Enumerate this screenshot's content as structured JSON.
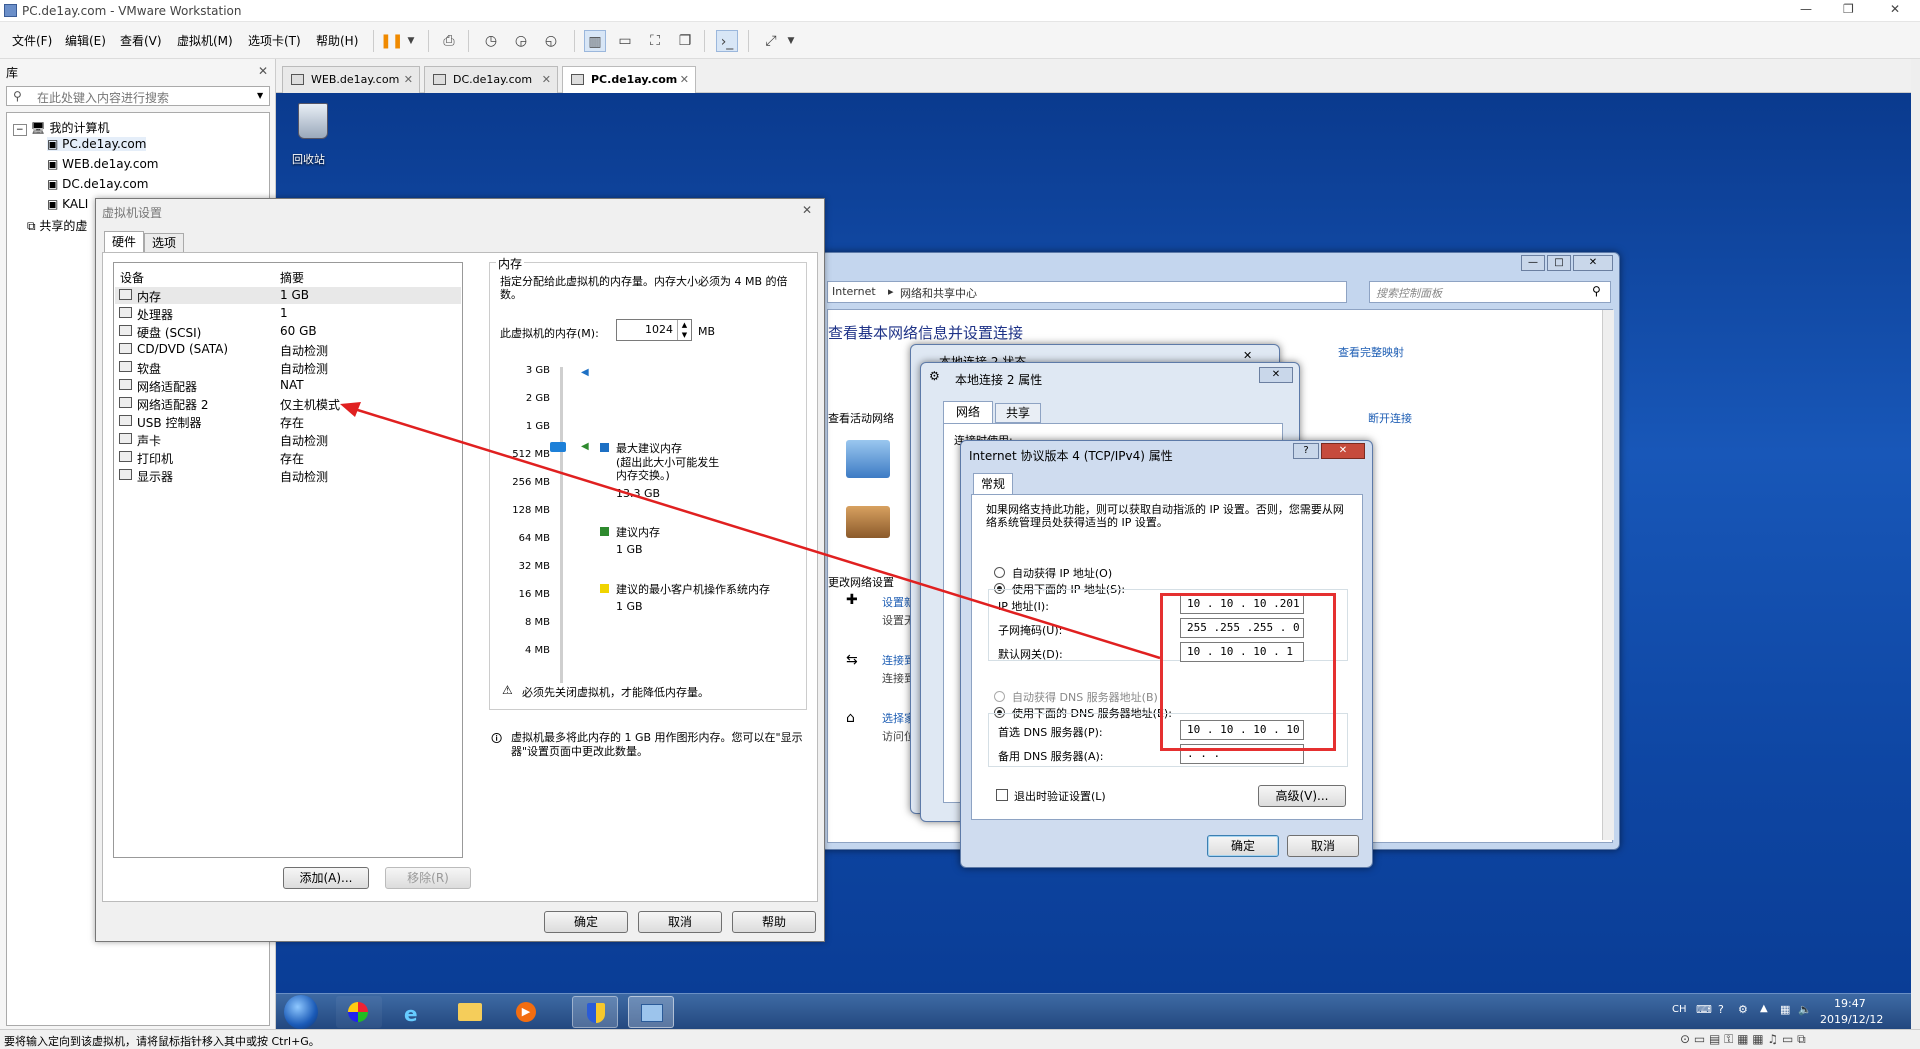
{
  "window": {
    "title": "PC.de1ay.com - VMware Workstation",
    "controls": [
      "—",
      "❐",
      "✕"
    ]
  },
  "menu": [
    "文件(F)",
    "编辑(E)",
    "查看(V)",
    "虚拟机(M)",
    "选项卡(T)",
    "帮助(H)"
  ],
  "library": {
    "title": "库",
    "close": "✕",
    "search_placeholder": "在此处键入内容进行搜索",
    "tree": {
      "root": "我的计算机",
      "items": [
        "PC.de1ay.com",
        "WEB.de1ay.com",
        "DC.de1ay.com",
        "KALI"
      ],
      "shared": "共享的虚"
    }
  },
  "tabs": [
    {
      "label": "WEB.de1ay.com"
    },
    {
      "label": "DC.de1ay.com"
    },
    {
      "label": "PC.de1ay.com"
    }
  ],
  "desktop": {
    "recycle_bin": "回收站"
  },
  "vm_settings": {
    "title": "虚拟机设置",
    "tabs": [
      "硬件",
      "选项"
    ],
    "columns": [
      "设备",
      "摘要"
    ],
    "devices": [
      {
        "name": "内存",
        "summary": "1 GB"
      },
      {
        "name": "处理器",
        "summary": "1"
      },
      {
        "name": "硬盘 (SCSI)",
        "summary": "60 GB"
      },
      {
        "name": "CD/DVD (SATA)",
        "summary": "自动检测"
      },
      {
        "name": "软盘",
        "summary": "自动检测"
      },
      {
        "name": "网络适配器",
        "summary": "NAT"
      },
      {
        "name": "网络适配器 2",
        "summary": "仅主机模式"
      },
      {
        "name": "USB 控制器",
        "summary": "存在"
      },
      {
        "name": "声卡",
        "summary": "自动检测"
      },
      {
        "name": "打印机",
        "summary": "存在"
      },
      {
        "name": "显示器",
        "summary": "自动检测"
      }
    ],
    "memory": {
      "heading": "内存",
      "desc": "指定分配给此虚拟机的内存量。内存大小必须为 4 MB 的倍数。",
      "label": "此虚拟机的内存(M):",
      "value": "1024",
      "unit": "MB",
      "scale": [
        "3 GB",
        "2 GB",
        "1 GB",
        "512 MB",
        "256 MB",
        "128 MB",
        "64 MB",
        "32 MB",
        "16 MB",
        "8 MB",
        "4 MB"
      ],
      "max_label": "最大建议内存",
      "max_note": "(超出此大小可能发生内存交换。)",
      "max_value": "13.3 GB",
      "rec_label": "建议内存",
      "rec_value": "1 GB",
      "min_label": "建议的最小客户机操作系统内存",
      "min_value": "1 GB",
      "warning": "必须先关闭虚拟机，才能降低内存量。",
      "info": "虚拟机最多将此内存的 1 GB 用作图形内存。您可以在\"显示器\"设置页面中更改此数量。"
    },
    "buttons": {
      "add": "添加(A)...",
      "remove": "移除(R)",
      "ok": "确定",
      "cancel": "取消",
      "help": "帮助"
    }
  },
  "network_center": {
    "breadcrumb": [
      "Internet",
      "网络和共享中心"
    ],
    "search_placeholder": "搜索控制面板",
    "heading": "查看基本网络信息并设置连接",
    "full_map": "查看完整映射",
    "active_networks": "查看活动网络",
    "disconnect": "断开连接",
    "change_settings": "更改网络设置",
    "links": [
      "设置新",
      "连接到",
      "选择家庭"
    ],
    "sublinks": [
      "设置无",
      "连接到",
      "访问位于其他"
    ],
    "controls": [
      "—",
      "□",
      "✕"
    ]
  },
  "local_conn_status": {
    "title": "本地连接 2 状态"
  },
  "local_conn_props": {
    "title": "本地连接 2 属性",
    "tabs": [
      "网络",
      "共享"
    ],
    "line": "连接时使用:"
  },
  "ipv4": {
    "title": "Internet 协议版本 4 (TCP/IPv4) 属性",
    "help": "?",
    "tab": "常规",
    "desc": "如果网络支持此功能，则可以获取自动指派的 IP 设置。否则，您需要从网络系统管理员处获得适当的 IP 设置。",
    "auto_ip": "自动获得 IP 地址(O)",
    "manual_ip": "使用下面的 IP 地址(S):",
    "ip_label": "IP 地址(I):",
    "ip": "10 . 10 . 10 .201",
    "mask_label": "子网掩码(U):",
    "mask": "255 .255 .255 . 0",
    "gw_label": "默认网关(D):",
    "gw": "10 . 10 . 10 . 1",
    "auto_dns": "自动获得 DNS 服务器地址(B)",
    "manual_dns": "使用下面的 DNS 服务器地址(E):",
    "dns1_label": "首选 DNS 服务器(P):",
    "dns1": "10 . 10 . 10 . 10",
    "dns2_label": "备用 DNS 服务器(A):",
    "dns2": " .  .  . ",
    "validate": "退出时验证设置(L)",
    "advanced": "高级(V)...",
    "ok": "确定",
    "cancel": "取消"
  },
  "tray": {
    "lang": "CH",
    "time": "19:47",
    "date": "2019/12/12"
  },
  "status_text": "要将输入定向到该虚拟机，请将鼠标指针移入其中或按 Ctrl+G。",
  "colors": {
    "highlight_box": "#e53030",
    "arrow": "#e02020",
    "desktop": "#1251b0"
  }
}
